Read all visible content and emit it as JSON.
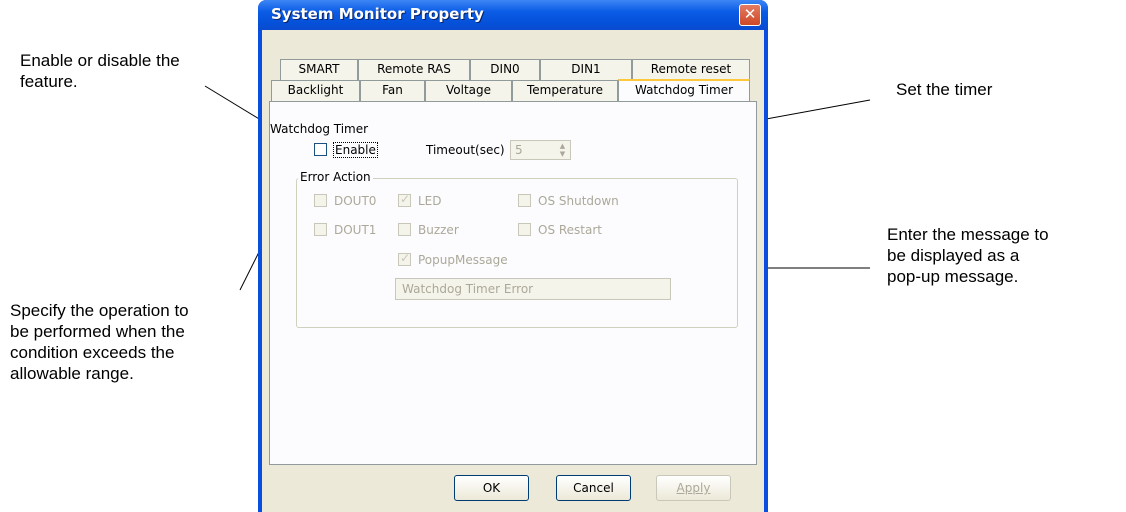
{
  "window": {
    "title": "System Monitor Property"
  },
  "tabs_row1": [
    "SMART",
    "Remote RAS",
    "DIN0",
    "DIN1",
    "Remote reset"
  ],
  "tabs_row2": [
    "Backlight",
    "Fan",
    "Voltage",
    "Temperature",
    "Watchdog Timer"
  ],
  "active_tab": "Watchdog Timer",
  "watchdog": {
    "group_label": "Watchdog Timer",
    "enable_label": "Enable",
    "enable_checked": false,
    "timeout_label": "Timeout(sec)",
    "timeout_value": "5"
  },
  "error_action": {
    "group_label": "Error Action",
    "dout0": {
      "label": "DOUT0",
      "checked": false
    },
    "dout1": {
      "label": "DOUT1",
      "checked": false
    },
    "led": {
      "label": "LED",
      "checked": true
    },
    "buzzer": {
      "label": "Buzzer",
      "checked": false
    },
    "os_shutdown": {
      "label": "OS Shutdown",
      "checked": false
    },
    "os_restart": {
      "label": "OS Restart",
      "checked": false
    },
    "popup": {
      "label": "PopupMessage",
      "checked": true
    },
    "message_value": "Watchdog Timer Error"
  },
  "buttons": {
    "ok": "OK",
    "cancel": "Cancel",
    "apply": "Apply"
  },
  "callouts": {
    "enable": "Enable or disable the\nfeature.",
    "timer": "Set the timer",
    "message": "Enter the message to\nbe displayed as a\npop-up message.",
    "operation": "Specify the operation to\nbe performed when the\ncondition exceeds the\nallowable range."
  }
}
